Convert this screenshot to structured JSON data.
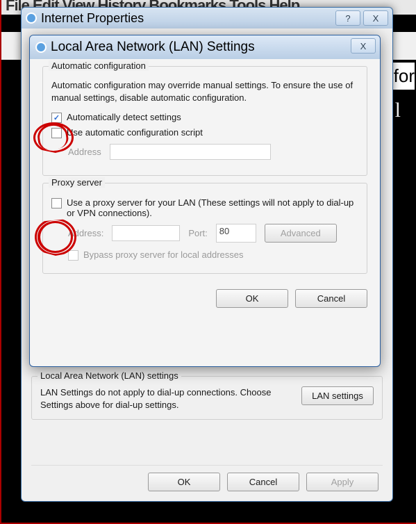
{
  "bg": {
    "menubar": "File  Edit  View  History  Bookmarks  Tools  Help",
    "for": "for",
    "side": "p. l"
  },
  "parent": {
    "title": "Internet Properties",
    "help_btn": "?",
    "close_btn": "X",
    "lan_group_title": "Local Area Network (LAN) settings",
    "lan_desc": "LAN Settings do not apply to dial-up connections. Choose Settings above for dial-up settings.",
    "lan_settings_btn": "LAN settings",
    "ok": "OK",
    "cancel": "Cancel",
    "apply": "Apply"
  },
  "lan": {
    "title": "Local Area Network (LAN) Settings",
    "close_btn": "X",
    "auto": {
      "group_title": "Automatic configuration",
      "desc": "Automatic configuration may override manual settings.  To ensure the use of manual settings, disable automatic configuration.",
      "auto_detect": "Automatically detect settings",
      "auto_detect_checked": true,
      "use_script": "Use automatic configuration script",
      "use_script_checked": false,
      "address_label": "Address",
      "address_value": ""
    },
    "proxy": {
      "group_title": "Proxy server",
      "use_proxy": "Use a proxy server for your LAN (These settings will not apply to dial-up or VPN connections).",
      "use_proxy_checked": false,
      "address_label": "Address:",
      "address_value": "",
      "port_label": "Port:",
      "port_value": "80",
      "advanced": "Advanced",
      "bypass": "Bypass proxy server for local addresses",
      "bypass_checked": false
    },
    "ok": "OK",
    "cancel": "Cancel"
  }
}
